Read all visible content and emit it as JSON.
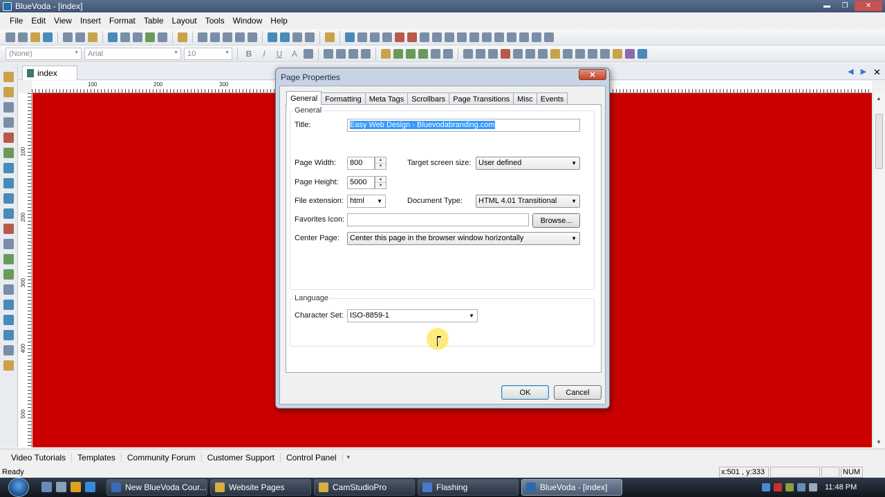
{
  "window": {
    "title": "BlueVoda - [index]"
  },
  "menu": [
    "File",
    "Edit",
    "View",
    "Insert",
    "Format",
    "Table",
    "Layout",
    "Tools",
    "Window",
    "Help"
  ],
  "format_toolbar": {
    "style": "(None)",
    "font": "Arial",
    "size": "10",
    "bold": "B",
    "italic": "I",
    "underline": "U",
    "fontcolor": "A"
  },
  "document": {
    "tab_label": "index",
    "canvas_color": "#cc0000"
  },
  "ruler": {
    "h": [
      "100",
      "200",
      "300"
    ],
    "v": [
      "100",
      "200",
      "300",
      "400",
      "500"
    ]
  },
  "dialog": {
    "title": "Page Properties",
    "close": "✕",
    "tabs": [
      "General",
      "Formatting",
      "Meta Tags",
      "Scrollbars",
      "Page Transitions",
      "Misc",
      "Events"
    ],
    "active_tab": "General",
    "general_group": "General",
    "title_label": "Title:",
    "title_value": "Easy Web Design - Bluevodabranding.com",
    "page_width_label": "Page Width:",
    "page_width": "800",
    "page_height_label": "Page Height:",
    "page_height": "5000",
    "target_label": "Target screen size:",
    "target_value": "User defined",
    "file_ext_label": "File extension:",
    "file_ext": "html",
    "doctype_label": "Document Type:",
    "doctype": "HTML 4.01 Transitional",
    "favicon_label": "Favorites Icon:",
    "favicon_value": "",
    "browse": "Browse...",
    "center_label": "Center Page:",
    "center_value": "Center this page in the browser window horizontally",
    "language_group": "Language",
    "charset_label": "Character Set:",
    "charset_value": "ISO-8859-1",
    "ok": "OK",
    "cancel": "Cancel"
  },
  "links": [
    "Video Tutorials",
    "Templates",
    "Community Forum",
    "Customer Support",
    "Control Panel"
  ],
  "status": {
    "text": "Ready",
    "coords": "x:501 , y:333",
    "num": "NUM"
  },
  "taskbar": {
    "buttons": [
      "New BlueVoda Cour...",
      "Website Pages",
      "CamStudioPro",
      "Flashing",
      "BlueVoda - [index]"
    ],
    "clock": "11:48 PM"
  },
  "colors": {
    "accent": "#3399ff",
    "title_bar": "#3e5272",
    "dialog_frame": "#c8d4e4"
  }
}
